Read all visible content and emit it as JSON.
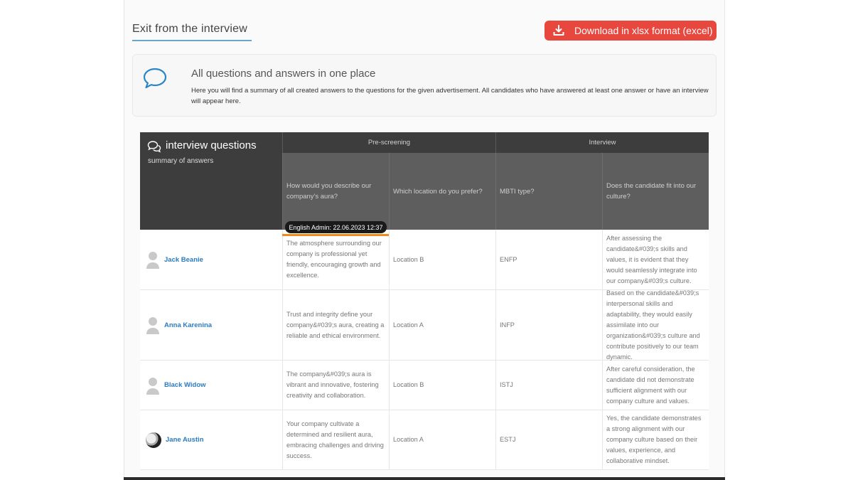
{
  "header": {
    "exit_title": "Exit from the interview",
    "download_label": "Download in xlsx format (excel)"
  },
  "info": {
    "title": "All questions and answers in one place",
    "text": "Here you will find a summary of all created answers to the questions for the given advertisement. All candidates who have answered at least one answer or have an interview will appear here."
  },
  "table": {
    "title": "interview questions",
    "subtitle": "summary of answers",
    "groups": {
      "pre": "Pre-screening",
      "int": "Interview"
    },
    "questions": [
      "How would you describe our company's aura?",
      "Which location do you prefer?",
      "MBTI type?",
      "Does the candidate fit into our culture?"
    ],
    "tooltip": "English Admin: 22.06.2023 12:37",
    "rows": [
      {
        "name": "Jack Beanie",
        "aura": "The atmosphere surrounding our company is professional yet friendly, encouraging growth and excellence.",
        "location": "Location B",
        "mbti": "ENFP",
        "culture": "After assessing the candidate&#039;s skills and values, it is evident that they would seamlessly integrate into our company&#039;s culture."
      },
      {
        "name": "Anna Karenina",
        "aura": "Trust and integrity define your company&#039;s aura, creating a reliable and ethical environment.",
        "location": "Location A",
        "mbti": "INFP",
        "culture": "Based on the candidate&#039;s interpersonal skills and adaptability, they would easily assimilate into our organization&#039;s culture and contribute positively to our team dynamic."
      },
      {
        "name": "Black Widow",
        "aura": "The company&#039;s aura is vibrant and innovative, fostering creativity and collaboration.",
        "location": "Location B",
        "mbti": "ISTJ",
        "culture": "After careful consideration, the candidate did not demonstrate sufficient alignment with our company culture and values."
      },
      {
        "name": "Jane Austin",
        "aura": "Your company cultivate a determined and resilient aura, embracing challenges and driving success.",
        "location": "Location A",
        "mbti": "ESTJ",
        "culture": "Yes, the candidate demonstrates a strong alignment with our company culture based on their values, experience, and collaborative mindset."
      }
    ]
  },
  "colors": {
    "accent_red": "#e8473e",
    "header_dark": "#3d3d3d",
    "question_bg": "#5e5e5e",
    "link_blue": "#2a7cc2",
    "tooltip_line": "#f08a1c"
  }
}
